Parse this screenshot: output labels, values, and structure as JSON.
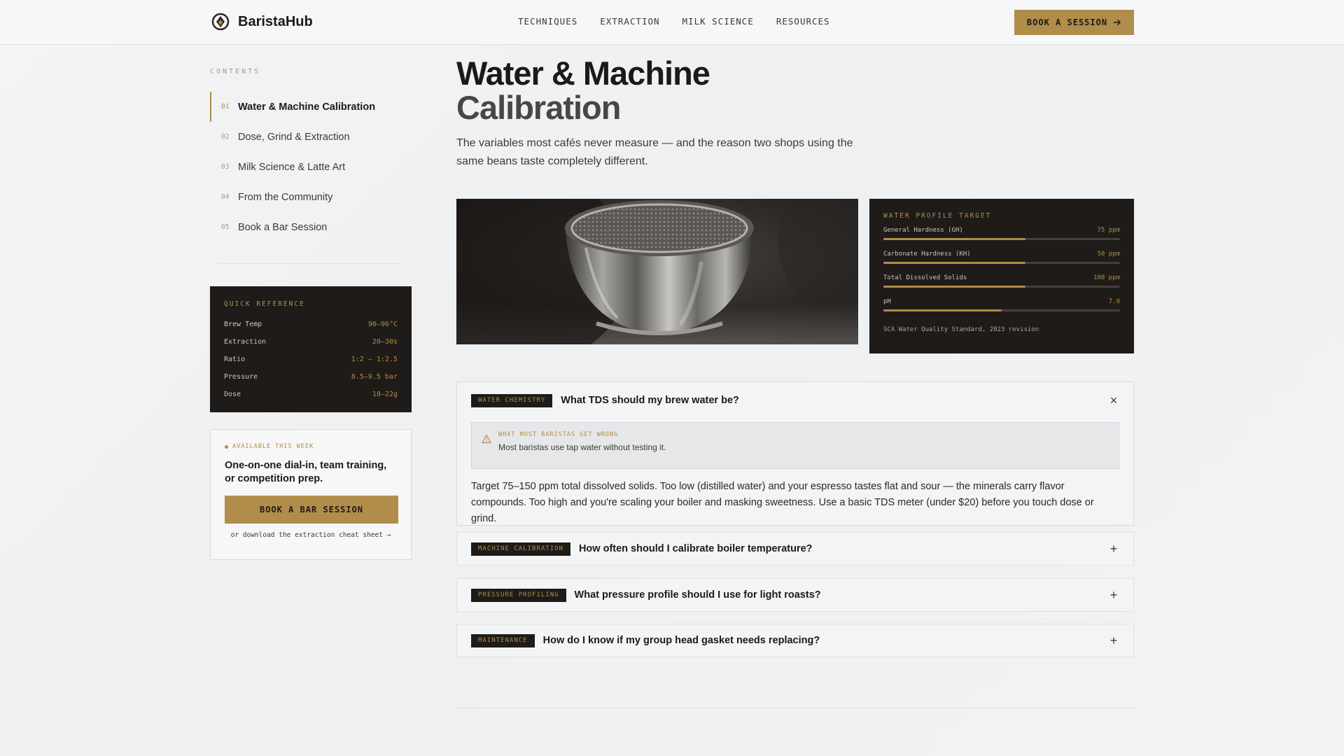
{
  "brand": {
    "name": "BaristaHub"
  },
  "nav": {
    "items": [
      {
        "label": "TECHNIQUES"
      },
      {
        "label": "EXTRACTION"
      },
      {
        "label": "MILK SCIENCE"
      },
      {
        "label": "RESOURCES"
      }
    ]
  },
  "header_cta": {
    "label": "BOOK A SESSION"
  },
  "toc": {
    "title": "CONTENTS",
    "items": [
      {
        "num": "01",
        "label": "Water & Machine Calibration",
        "active": true
      },
      {
        "num": "02",
        "label": "Dose, Grind & Extraction"
      },
      {
        "num": "03",
        "label": "Milk Science & Latte Art"
      },
      {
        "num": "04",
        "label": "From the Community"
      },
      {
        "num": "05",
        "label": "Book a Bar Session"
      }
    ]
  },
  "quick_reference": {
    "title": "QUICK REFERENCE",
    "rows": [
      {
        "key": "Brew Temp",
        "value": "90–96°C"
      },
      {
        "key": "Extraction",
        "value": "20–30s"
      },
      {
        "key": "Ratio",
        "value": "1:2 – 1:2.5"
      },
      {
        "key": "Pressure",
        "value": "8.5–9.5 bar"
      },
      {
        "key": "Dose",
        "value": "18–22g"
      }
    ]
  },
  "booking": {
    "availability": "AVAILABLE THIS WEEK",
    "text": "One-on-one dial-in, team training, or competition prep.",
    "button": "BOOK A BAR SESSION",
    "link": "or download the extraction cheat sheet →"
  },
  "page": {
    "title_line1": "Water & Machine",
    "title_line2": "Calibration",
    "subtitle": "The variables most cafés never measure — and the reason two shops using the same beans taste completely different."
  },
  "water_profile": {
    "title": "WATER PROFILE TARGET",
    "rows": [
      {
        "key": "General Hardness (GH)",
        "value": "75 ppm",
        "level": 0.6
      },
      {
        "key": "Carbonate Hardness (KH)",
        "value": "50 ppm",
        "level": 0.6
      },
      {
        "key": "Total Dissolved Solids",
        "value": "100 ppm",
        "level": 0.6
      },
      {
        "key": "pH",
        "value": "7.0",
        "level": 0.5
      }
    ],
    "footnote": "SCA Water Quality Standard, 2023 revision"
  },
  "faq": {
    "open": {
      "tag": "WATER CHEMISTRY",
      "question": "What TDS should my brew water be?",
      "toggle": "×",
      "warning_title": "WHAT MOST BARISTAS GET WRONG",
      "warning_text": "Most baristas use tap water without testing it.",
      "answer": "Target 75–150 ppm total dissolved solids. Too low (distilled water) and your espresso tastes flat and sour — the minerals carry flavor compounds. Too high and you're scaling your boiler and masking sweetness. Use a basic TDS meter (under $20) before you touch dose or grind."
    },
    "items": [
      {
        "tag": "MACHINE CALIBRATION",
        "question": "How often should I calibrate boiler temperature?",
        "toggle": "+"
      },
      {
        "tag": "PRESSURE PROFILING",
        "question": "What pressure profile should I use for light roasts?",
        "toggle": "+"
      },
      {
        "tag": "MAINTENANCE",
        "question": "How do I know if my group head gasket needs replacing?",
        "toggle": "+"
      }
    ]
  },
  "colors": {
    "accent": "#b08d4a",
    "dark_panel": "#1f1b18"
  }
}
